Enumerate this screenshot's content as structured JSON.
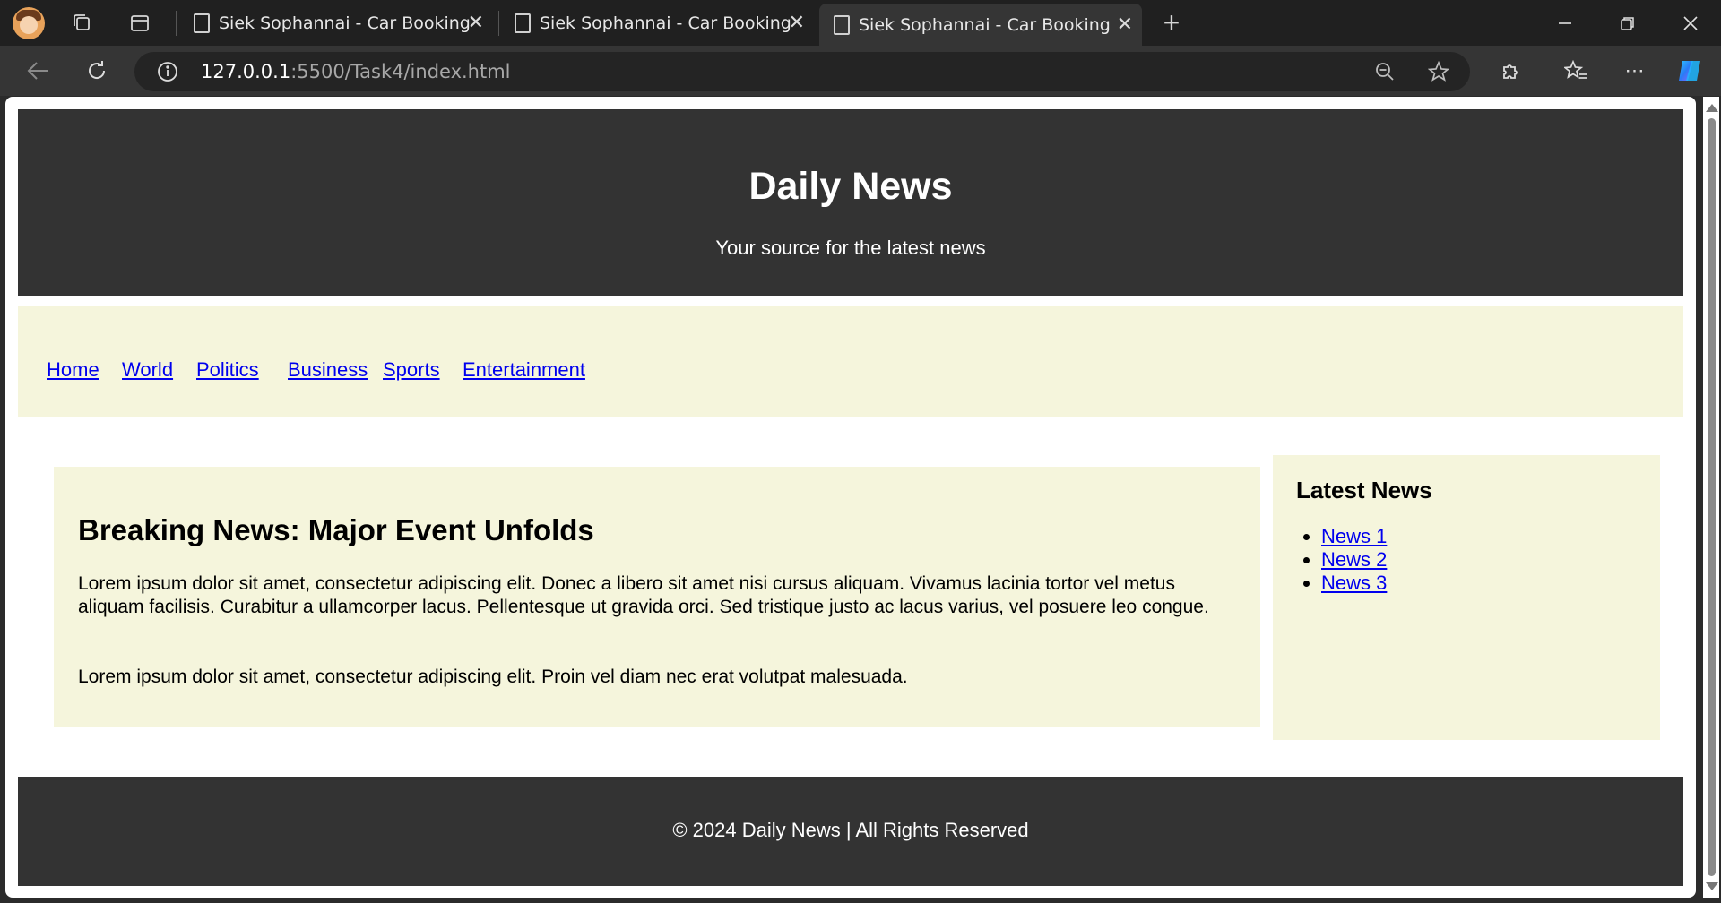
{
  "browser": {
    "tabs": [
      {
        "title": "Siek Sophannai - Car Booking",
        "active": false
      },
      {
        "title": "Siek Sophannai - Car Booking",
        "active": false
      },
      {
        "title": "Siek Sophannai - Car Booking",
        "active": true
      }
    ],
    "new_tab_symbol": "+",
    "address": {
      "host": "127.0.0.1",
      "path": ":5500/Task4/index.html"
    },
    "icons": [
      "workspaces-icon",
      "vertical-tabs-icon",
      "back-icon",
      "reload-icon",
      "site-info-icon",
      "zoom-out-icon",
      "favorite-star-icon",
      "extensions-icon",
      "favorites-icon",
      "more-icon",
      "copilot-icon",
      "minimize-icon",
      "restore-icon",
      "window-close-icon"
    ]
  },
  "page": {
    "header": {
      "title": "Daily News",
      "tagline": "Your source for the latest news"
    },
    "nav": [
      "Home",
      "World",
      "Politics",
      "Business",
      "Sports",
      "Entertainment"
    ],
    "article": {
      "heading": "Breaking News: Major Event Unfolds",
      "paragraphs": [
        "Lorem ipsum dolor sit amet, consectetur adipiscing elit. Donec a libero sit amet nisi cursus aliquam. Vivamus lacinia tortor vel metus aliquam facilisis. Curabitur a ullamcorper lacus. Pellentesque ut gravida orci. Sed tristique justo ac lacus varius, vel posuere leo congue.",
        "Lorem ipsum dolor sit amet, consectetur adipiscing elit. Proin vel diam nec erat volutpat malesuada."
      ]
    },
    "sidebar": {
      "heading": "Latest News",
      "links": [
        "News 1",
        "News 2",
        "News 3"
      ]
    },
    "footer": {
      "text": "© 2024 Daily News | All Rights Reserved"
    }
  },
  "colors": {
    "header_bg": "#333333",
    "panel_bg": "#f5f5dc",
    "link": "#0000ee"
  }
}
